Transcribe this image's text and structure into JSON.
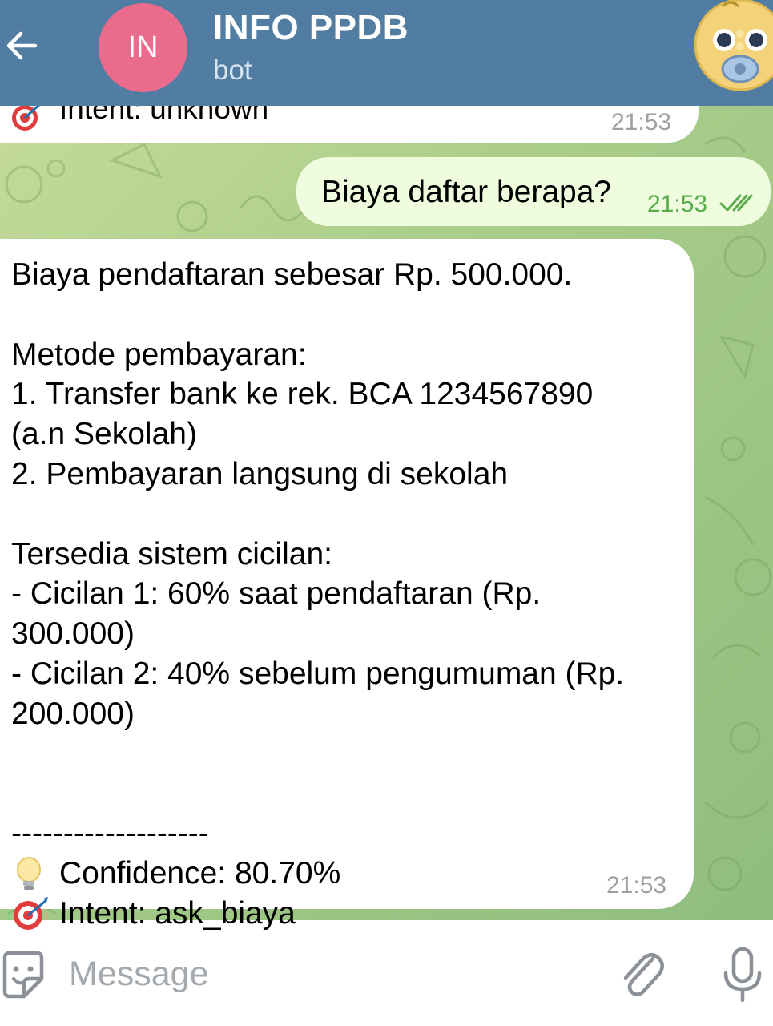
{
  "header": {
    "title": "INFO PPDB",
    "subtitle": "bot",
    "avatar_initials": "IN",
    "avatar_color": "#ea6b8b",
    "bar_color": "#517da2",
    "back_icon": "arrow-left-icon",
    "profile_badge_icon": "baby-emoji-icon"
  },
  "messages": {
    "previous": {
      "text": "Intent: unknown",
      "time": "21:53",
      "icon": "target-icon"
    },
    "outgoing": {
      "text": "Biaya daftar berapa?",
      "time": "21:53",
      "status_icon": "double-check-icon"
    },
    "reply": {
      "lines": [
        "Biaya pendaftaran sebesar Rp. 500.000.",
        "",
        "Metode pembayaran:",
        "1. Transfer bank ke rek. BCA 1234567890",
        "(a.n Sekolah)",
        "2. Pembayaran langsung di sekolah",
        "",
        "Tersedia sistem cicilan:",
        "- Cicilan 1: 60% saat pendaftaran (Rp.",
        "300.000)",
        "- Cicilan 2: 40% sebelum pengumuman (Rp.",
        "200.000)",
        "",
        "",
        "-------------------"
      ],
      "confidence": "Confidence: 80.70%",
      "intent": "Intent: ask_biaya",
      "time": "21:53"
    }
  },
  "input_bar": {
    "placeholder": "Message",
    "sticker_icon": "sticker-icon",
    "attach_icon": "paperclip-icon",
    "mic_icon": "microphone-icon"
  },
  "colors": {
    "incoming_bubble": "#ffffff",
    "outgoing_bubble": "#effdde",
    "time_outgoing": "#5aac4d"
  }
}
